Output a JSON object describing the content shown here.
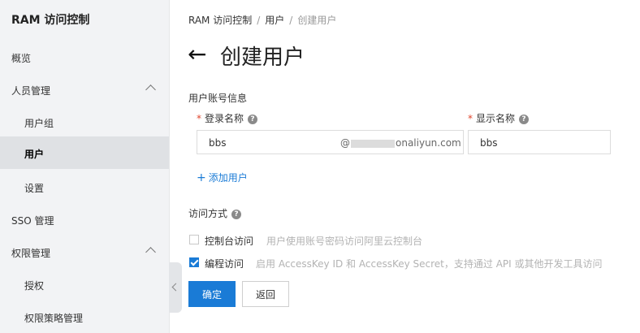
{
  "sidebar": {
    "title": "RAM 访问控制",
    "items": [
      {
        "label": "概览"
      },
      {
        "label": "人员管理"
      },
      {
        "label": "用户组"
      },
      {
        "label": "用户"
      },
      {
        "label": "设置"
      },
      {
        "label": "SSO 管理"
      },
      {
        "label": "权限管理"
      },
      {
        "label": "授权"
      },
      {
        "label": "权限策略管理"
      }
    ]
  },
  "breadcrumb": {
    "items": [
      "RAM 访问控制",
      "用户",
      "创建用户"
    ],
    "separator": "/"
  },
  "page": {
    "back_icon": "←",
    "title": "创建用户"
  },
  "account_info": {
    "section_label": "用户账号信息",
    "login_name": {
      "label": "登录名称",
      "value": "bbs",
      "suffix_start": "@",
      "suffix_end": "onaliyun.com"
    },
    "display_name": {
      "label": "显示名称",
      "value": "bbs"
    },
    "required_mark": "*",
    "help_icon": "?",
    "add_user": {
      "plus": "+",
      "label": "添加用户"
    }
  },
  "access": {
    "section_label": "访问方式",
    "help_icon": "?",
    "options": [
      {
        "label": "控制台访问",
        "description": "用户使用账号密码访问阿里云控制台",
        "checked": false
      },
      {
        "label": "编程访问",
        "description": "启用 AccessKey ID 和 AccessKey Secret，支持通过 API 或其他开发工具访问",
        "checked": true
      }
    ]
  },
  "buttons": {
    "confirm": "确定",
    "back": "返回"
  },
  "colors": {
    "accent": "#1a7bd6",
    "required": "#e0452c",
    "sidebar_bg": "#f2f3f5",
    "sidebar_active": "#dfe1e4"
  }
}
